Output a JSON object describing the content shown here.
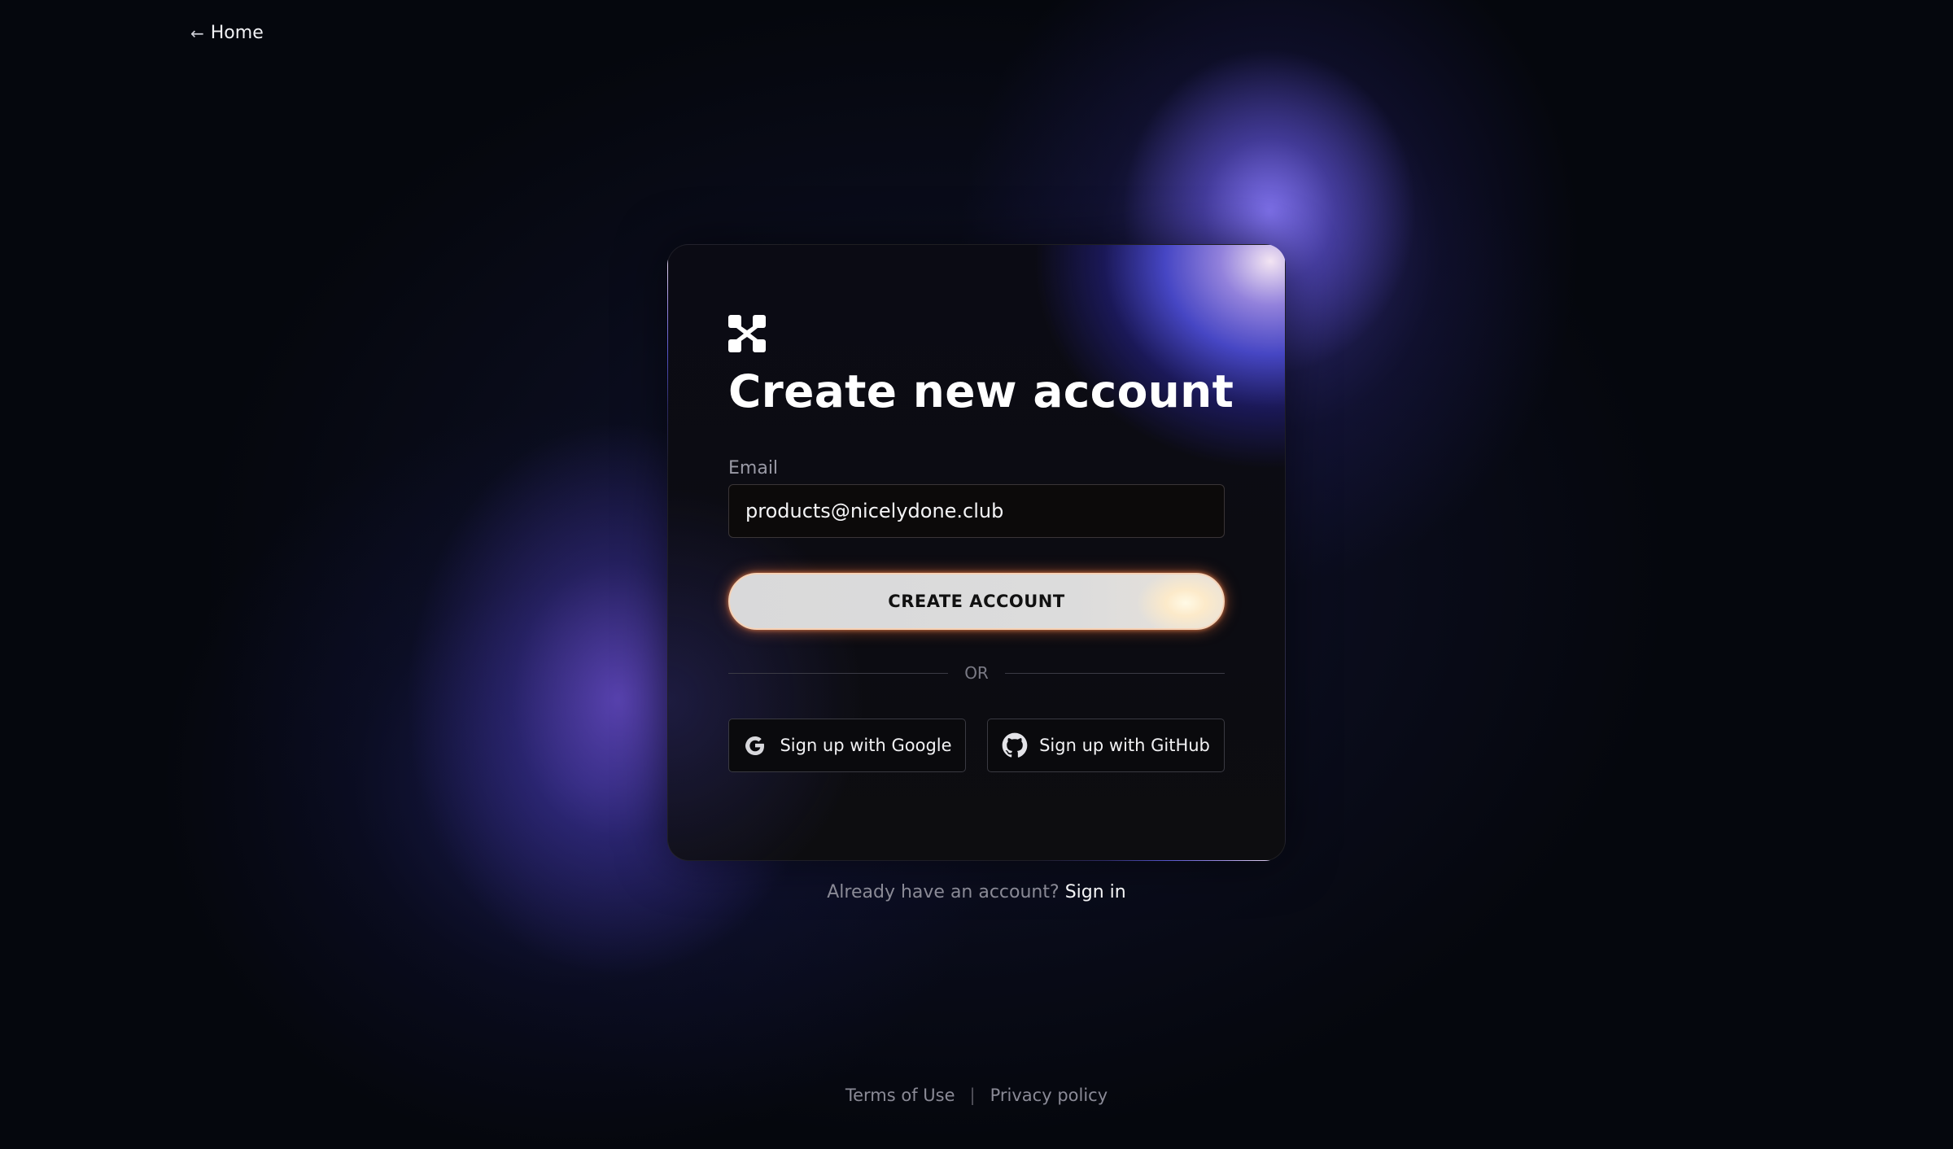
{
  "nav": {
    "back_label": "Home"
  },
  "card": {
    "title": "Create new account",
    "email_label": "Email",
    "email_value": "products@nicelydone.club",
    "create_button_label": "CREATE ACCOUNT",
    "divider_label": "OR",
    "google_button_label": "Sign up with Google",
    "github_button_label": "Sign up with GitHub"
  },
  "signin": {
    "prompt": "Already have an account?",
    "link_label": "Sign in"
  },
  "footer": {
    "terms_label": "Terms of Use",
    "separator": "|",
    "privacy_label": "Privacy policy"
  },
  "icons": {
    "back": "arrow-left-icon",
    "logo": "brand-logo",
    "google": "google-icon",
    "github": "github-icon"
  },
  "colors": {
    "background": "#05070d",
    "accent_glow": "#7b6cff",
    "button_glow": "#ff7a3c"
  }
}
